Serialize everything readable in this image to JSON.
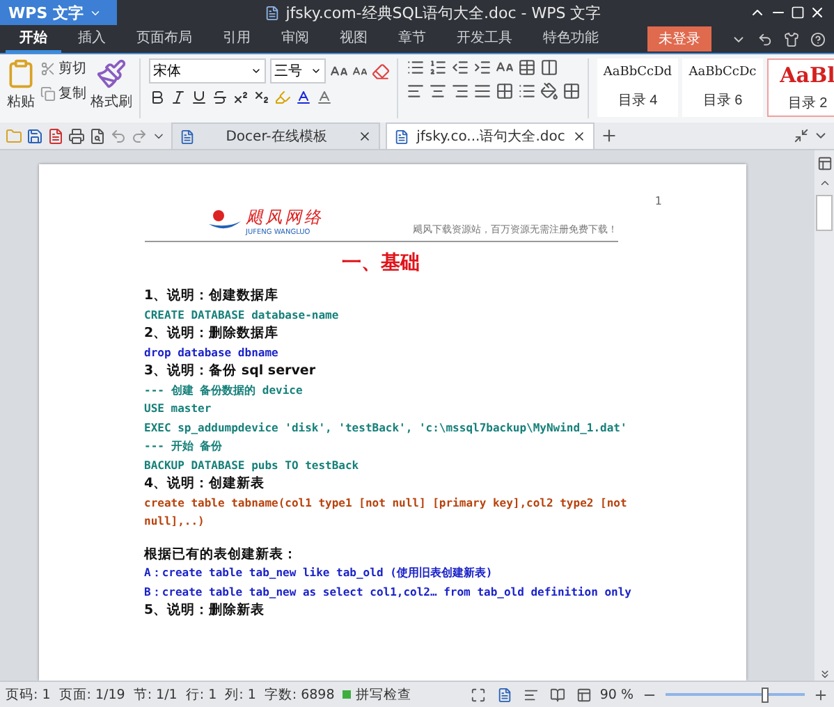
{
  "window": {
    "app_button": "WPS 文字",
    "title": "jfsky.com-经典SQL语句大全.doc - WPS 文字"
  },
  "menu_tabs": [
    {
      "label": "开始",
      "selected": true
    },
    {
      "label": "插入",
      "selected": false
    },
    {
      "label": "页面布局",
      "selected": false
    },
    {
      "label": "引用",
      "selected": false
    },
    {
      "label": "审阅",
      "selected": false
    },
    {
      "label": "视图",
      "selected": false
    },
    {
      "label": "章节",
      "selected": false
    },
    {
      "label": "开发工具",
      "selected": false
    },
    {
      "label": "特色功能",
      "selected": false
    }
  ],
  "login_button": "未登录",
  "ribbon": {
    "paste": "粘贴",
    "cut": "剪切",
    "copy": "复制",
    "format_painter": "格式刷",
    "font_name": "宋体",
    "font_size": "三号",
    "styles": [
      {
        "sample": "AaBbCcDd",
        "name": "目录 4",
        "kind": "small"
      },
      {
        "sample": "AaBbCcDc",
        "name": "目录 6",
        "kind": "small"
      },
      {
        "sample": "AaBl",
        "name": "目录 2",
        "kind": "big"
      }
    ]
  },
  "doc_tabs": [
    {
      "label": "Docer-在线模板",
      "selected": false
    },
    {
      "label": "jfsky.co...语句大全.doc",
      "selected": true
    }
  ],
  "page": {
    "logo_name": "飓风网络",
    "logo_sub": "JUFENG WANGLUO",
    "header_text": "飓风下载资源站，百万资源无需注册免费下载！",
    "page_number": "1",
    "title": "一、基础",
    "lines": [
      {
        "kind": "heading",
        "text": "1、说明：创建数据库"
      },
      {
        "kind": "code",
        "text": "CREATE DATABASE database-name",
        "color": "#16807a"
      },
      {
        "kind": "heading",
        "text": "2、说明：删除数据库"
      },
      {
        "kind": "code",
        "text": "drop database dbname",
        "color": "#1a22c8"
      },
      {
        "kind": "heading",
        "text": "3、说明：备份 sql server"
      },
      {
        "kind": "code",
        "text": "--- 创建 备份数据的 device",
        "color": "#16807a"
      },
      {
        "kind": "code",
        "text": "USE master",
        "color": "#16807a"
      },
      {
        "kind": "code",
        "text": "EXEC sp_addumpdevice 'disk', 'testBack', 'c:\\mssql7backup\\MyNwind_1.dat'",
        "color": "#16807a"
      },
      {
        "kind": "code",
        "text": "--- 开始 备份",
        "color": "#16807a"
      },
      {
        "kind": "code",
        "text": "BACKUP DATABASE pubs TO testBack",
        "color": "#16807a"
      },
      {
        "kind": "heading",
        "text": "4、说明：创建新表"
      },
      {
        "kind": "code",
        "text": "create table tabname(col1 type1 [not null] [primary key],col2 type2 [not null],..)",
        "color": "#b8420c"
      },
      {
        "kind": "heading",
        "text": "根据已有的表创建新表：",
        "spaced": true
      },
      {
        "kind": "code",
        "text": "A：create table tab_new like tab_old (使用旧表创建新表)",
        "color": "#1a22c8"
      },
      {
        "kind": "code",
        "text": "B：create table tab_new as select col1,col2… from tab_old definition only",
        "color": "#1a22c8"
      },
      {
        "kind": "heading",
        "text": "5、说明：删除新表"
      }
    ]
  },
  "status_bar": {
    "items": [
      "页码: 1",
      "页面: 1/19",
      "节: 1/1",
      "行: 1",
      "列: 1",
      "字数: 6898"
    ],
    "spell_check": "拼写检查",
    "zoom": "90 %",
    "zoom_level": {
      "level": 0.72
    }
  }
}
